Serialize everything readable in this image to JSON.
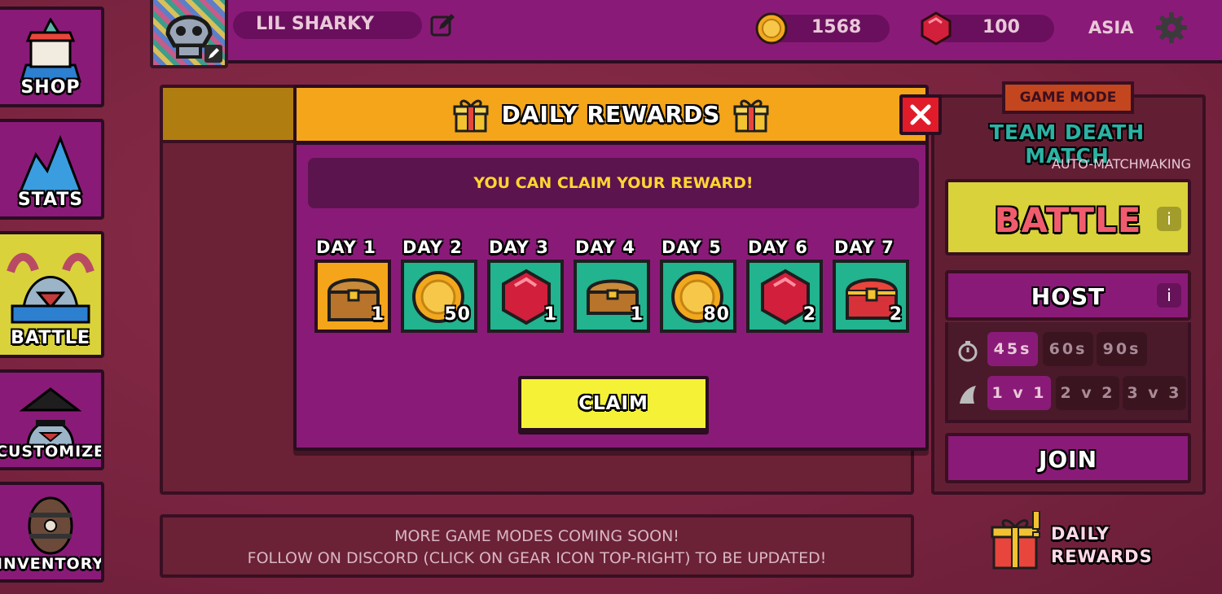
{
  "sidebar": {
    "items": [
      {
        "label": "SHOP",
        "icon": "shop-icon"
      },
      {
        "label": "STATS",
        "icon": "stats-shark-icon"
      },
      {
        "label": "BATTLE",
        "icon": "battle-shark-icon",
        "active": true
      },
      {
        "label": "CUSTOMIZE",
        "icon": "pirate-shark-icon"
      },
      {
        "label": "INVENTORY",
        "icon": "barrel-icon"
      }
    ]
  },
  "header": {
    "username": "LIL SHARKY",
    "coins": "1568",
    "gems": "100",
    "region": "ASIA"
  },
  "info": {
    "line1": "MORE GAME MODES COMING SOON!",
    "line2": "FOLLOW ON DISCORD (CLICK ON GEAR ICON TOP-RIGHT) TO BE UPDATED!"
  },
  "right_panel": {
    "badge": "GAME MODE",
    "mode": "TEAM DEATH MATCH",
    "matchmaking": "AUTO-MATCHMAKING",
    "battle_label": "BATTLE",
    "host_label": "HOST",
    "durations": [
      "45s",
      "60s",
      "90s"
    ],
    "selected_duration": "45s",
    "team_sizes": [
      "1 v 1",
      "2 v 2",
      "3 v 3"
    ],
    "selected_team_size": "1 v 1",
    "join_label": "JOIN",
    "daily_line1": "DAILY",
    "daily_line2": "REWARDS"
  },
  "modal": {
    "title": "DAILY REWARDS",
    "notice": "YOU CAN CLAIM YOUR REWARD!",
    "claim_label": "CLAIM",
    "days": [
      {
        "label": "DAY 1",
        "reward": "chest",
        "qty": "1"
      },
      {
        "label": "DAY 2",
        "reward": "coin",
        "qty": "50"
      },
      {
        "label": "DAY 3",
        "reward": "gem",
        "qty": "1"
      },
      {
        "label": "DAY 4",
        "reward": "chest",
        "qty": "1"
      },
      {
        "label": "DAY 5",
        "reward": "coin",
        "qty": "80"
      },
      {
        "label": "DAY 6",
        "reward": "gem",
        "qty": "2"
      },
      {
        "label": "DAY 7",
        "reward": "red-chest",
        "qty": "2"
      }
    ]
  },
  "colors": {
    "panel_purple": "#8a1a78",
    "header_orange": "#f4a51a",
    "tile_teal": "#22b38f",
    "claim_yellow": "#f5f136",
    "close_red": "#e01c2a",
    "notice_yellow": "#ffd533"
  }
}
